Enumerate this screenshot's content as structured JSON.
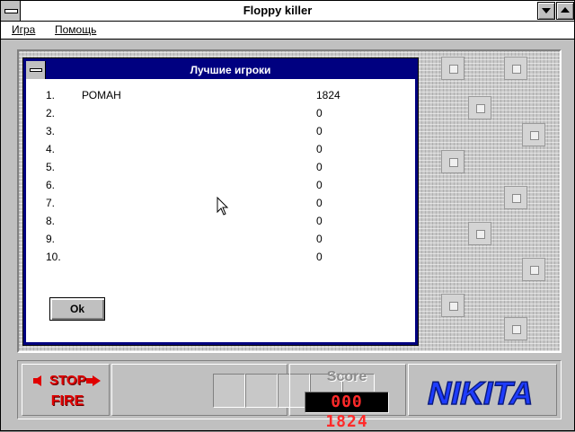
{
  "window": {
    "title": "Floppy killer"
  },
  "menu": {
    "items": [
      {
        "label": "Игра"
      },
      {
        "label": "Помощь"
      }
    ]
  },
  "dialog": {
    "title": "Лучшие игроки",
    "ok_label": "Ok",
    "rows": [
      {
        "rank": "1.",
        "name": "РОМАН",
        "score": "1824"
      },
      {
        "rank": "2.",
        "name": "",
        "score": "0"
      },
      {
        "rank": "3.",
        "name": "",
        "score": "0"
      },
      {
        "rank": "4.",
        "name": "",
        "score": "0"
      },
      {
        "rank": "5.",
        "name": "",
        "score": "0"
      },
      {
        "rank": "6.",
        "name": "",
        "score": "0"
      },
      {
        "rank": "7.",
        "name": "",
        "score": "0"
      },
      {
        "rank": "8.",
        "name": "",
        "score": "0"
      },
      {
        "rank": "9.",
        "name": "",
        "score": "0"
      },
      {
        "rank": "10.",
        "name": "",
        "score": "0"
      }
    ]
  },
  "panel": {
    "stop_label": "STOP",
    "fire_label": "FIRE",
    "score_label": "Score",
    "score_value": "000 1824",
    "logo_text": "NIKITA"
  },
  "colors": {
    "title_blue": "#000080",
    "lcd_red": "#ff2a2a",
    "control_red": "#e00000",
    "logo_blue": "#1e3cff"
  }
}
